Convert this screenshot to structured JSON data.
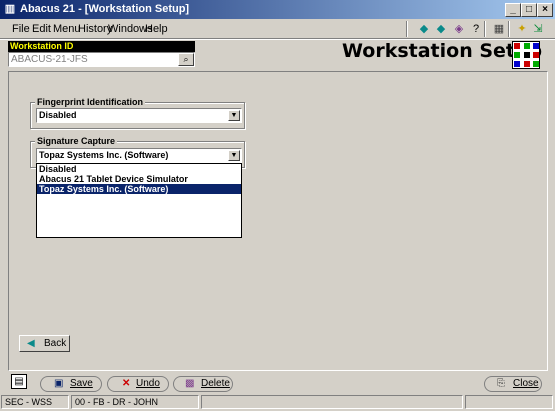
{
  "window": {
    "title": "Abacus 21 - [Workstation Setup]",
    "app_icon": "app-icon",
    "minimize_label": "_",
    "maximize_label": "□",
    "close_label": "×"
  },
  "menu": [
    "File",
    "Edit",
    "Menu",
    "History",
    "Windows",
    "Help"
  ],
  "toolbar": {
    "icons": [
      "arrow-left-icon",
      "arrow-right-icon",
      "refresh-icon",
      "help-icon",
      "calculator-icon",
      "run-icon",
      "exit-icon"
    ]
  },
  "workstation": {
    "label": "Workstation ID",
    "value": "ABACUS-21-JFS"
  },
  "page_title": "Workstation Setup",
  "fingerprint": {
    "label": "Fingerprint Identification",
    "value": "Disabled"
  },
  "signature": {
    "label": "Signature Capture",
    "value": "Topaz Systems Inc. (Software)",
    "options": [
      "Disabled",
      "Abacus 21 Tablet Device Simulator",
      "Topaz Systems Inc. (Software)"
    ],
    "selected_index": 2
  },
  "back_button": "Back",
  "bottom_bar": {
    "save": "Save",
    "undo": "Undo",
    "delete": "Delete",
    "close": "Close"
  },
  "status": {
    "cell1": "SEC - WSS",
    "cell2": "00 - FB - DR - JOHN",
    "cell3": "",
    "cell4": ""
  },
  "colors": {
    "titlebar_start": "#0a246a",
    "titlebar_end": "#a6caf0",
    "workstation_label_bg": "#000000",
    "workstation_label_text": "#ffff00",
    "selection": "#0a246a"
  }
}
